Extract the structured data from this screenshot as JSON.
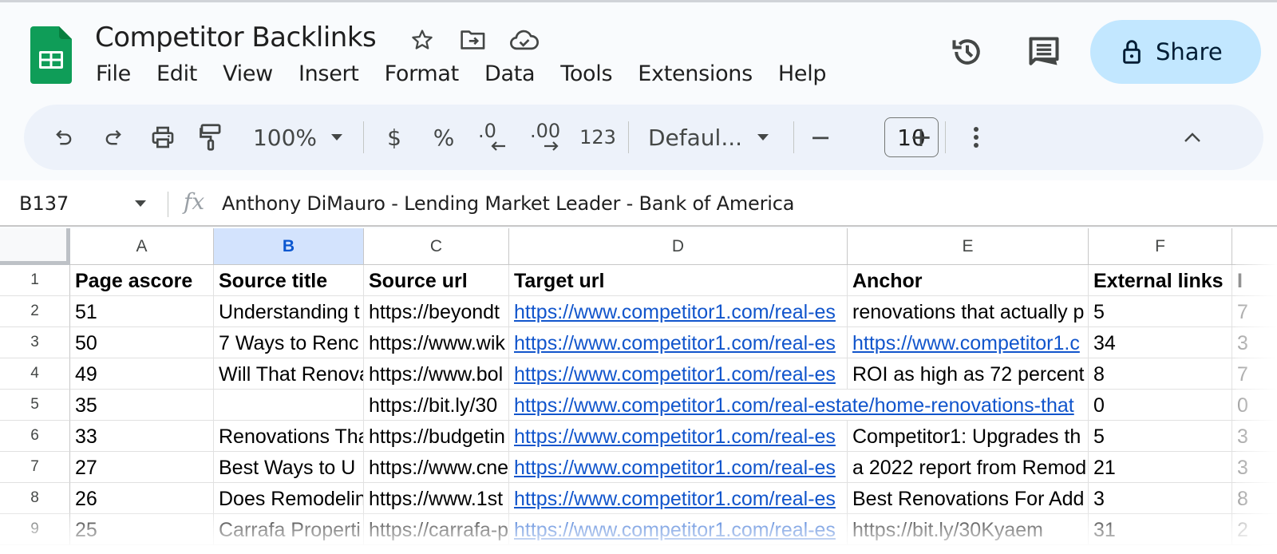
{
  "app": {
    "title": "Competitor Backlinks",
    "menu": [
      "File",
      "Edit",
      "View",
      "Insert",
      "Format",
      "Data",
      "Tools",
      "Extensions",
      "Help"
    ],
    "share_label": "Share",
    "icons": {
      "star": "star-icon",
      "move": "folder-move-icon",
      "cloud": "cloud-saved-icon",
      "history": "version-history-icon",
      "comments": "comments-icon",
      "lock": "lock-icon"
    },
    "brand_color": "#0f9d58",
    "share_bg": "#c2e7ff"
  },
  "toolbar": {
    "zoom": "100%",
    "currency": "$",
    "percent": "%",
    "decrease_decimal": ".0",
    "increase_decimal": ".00",
    "more_formats": "123",
    "font": "Defaul...",
    "font_size": "10",
    "minus": "−",
    "plus": "+"
  },
  "formula_bar": {
    "cell_ref": "B137",
    "fx": "fx",
    "value": "Anthony DiMauro - Lending Market Leader - Bank of America"
  },
  "sheet": {
    "columns": [
      "A",
      "B",
      "C",
      "D",
      "E",
      "F"
    ],
    "selected_column": "B",
    "row_numbers": [
      "1",
      "2",
      "3",
      "4",
      "5",
      "6",
      "7",
      "8",
      "9"
    ],
    "header_row": [
      "Page ascore",
      "Source title",
      "Source url",
      "Target url",
      "Anchor",
      "External links",
      "I"
    ],
    "rows": [
      {
        "a": "51",
        "b": "Understanding t",
        "c": "https://beyondt",
        "d": "https://www.competitor1.com/real-es",
        "e": "renovations that actually p",
        "e_link": false,
        "f": "5",
        "g": "7"
      },
      {
        "a": "50",
        "b": "7 Ways to Renc",
        "c": "https://www.wik",
        "d": "https://www.competitor1.com/real-es",
        "e": "https://www.competitor1.c",
        "e_link": true,
        "f": "34",
        "g": "3"
      },
      {
        "a": "49",
        "b": "Will That Renova",
        "c": "https://www.bol",
        "d": "https://www.competitor1.com/real-es",
        "e": "ROI as high as 72 percent",
        "e_link": false,
        "f": "8",
        "g": "7"
      },
      {
        "a": "35",
        "b": "",
        "c": "https://bit.ly/30",
        "d": "https://www.competitor1.com/real-estate/home-renovations-that",
        "e": "",
        "e_link": false,
        "f": "0",
        "g": "0"
      },
      {
        "a": "33",
        "b": "Renovations Tha",
        "c": "https://budgetin",
        "d": "https://www.competitor1.com/real-es",
        "e": "Competitor1: Upgrades th",
        "e_link": false,
        "f": "5",
        "g": "3"
      },
      {
        "a": "27",
        "b": "Best Ways to U",
        "c": "https://www.cne",
        "d": "https://www.competitor1.com/real-es",
        "e": "a 2022 report from Remod",
        "e_link": false,
        "f": "21",
        "g": "3"
      },
      {
        "a": "26",
        "b": "Does Remodelin",
        "c": "https://www.1st",
        "d": "https://www.competitor1.com/real-es",
        "e": "Best Renovations For Add",
        "e_link": false,
        "f": "3",
        "g": "8"
      },
      {
        "a": "25",
        "b": "Carrafa Properti",
        "c": "https://carrafa-p",
        "d": "https://www.competitor1.com/real-es",
        "e": "https://bit.ly/30Kyaem",
        "e_link": false,
        "f": "31",
        "g": "2"
      }
    ],
    "link_color": "#1155cc"
  }
}
